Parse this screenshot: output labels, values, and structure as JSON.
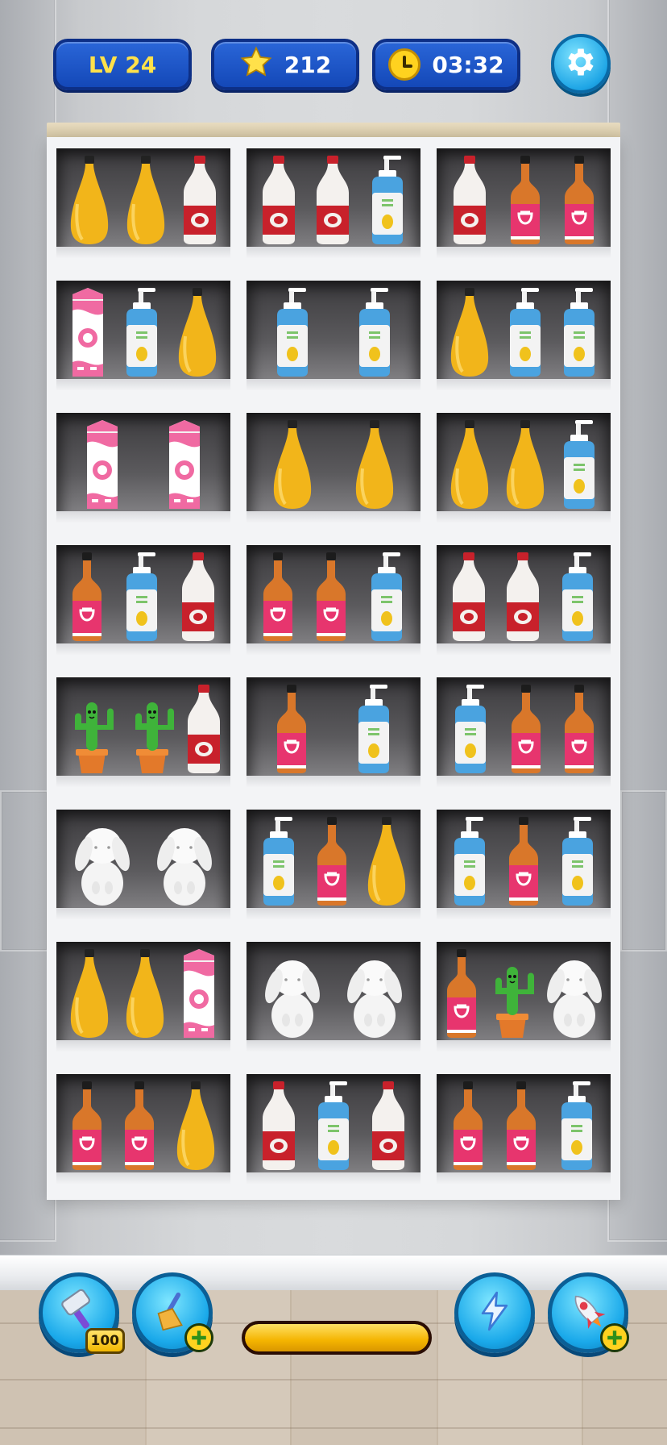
{
  "hud": {
    "level_label": "LV 24",
    "star_count": "212",
    "timer": "03:32",
    "star_icon": "star-icon",
    "clock_icon": "clock-icon",
    "settings_icon": "gear-icon"
  },
  "shelf": {
    "rows": [
      [
        [
          "mustard-bottle",
          "mustard-bottle",
          "milk-bottle"
        ],
        [
          "milk-bottle",
          "milk-bottle",
          "lotion-pump"
        ],
        [
          "milk-bottle",
          "sauce-bottle",
          "sauce-bottle"
        ]
      ],
      [
        [
          "milk-carton",
          "lotion-pump",
          "mustard-bottle"
        ],
        [
          "lotion-pump",
          "lotion-pump"
        ],
        [
          "mustard-bottle",
          "lotion-pump",
          "lotion-pump"
        ]
      ],
      [
        [
          "milk-carton",
          "milk-carton"
        ],
        [
          "mustard-bottle",
          "mustard-bottle"
        ],
        [
          "mustard-bottle",
          "mustard-bottle",
          "lotion-pump"
        ]
      ],
      [
        [
          "sauce-bottle",
          "lotion-pump",
          "milk-bottle"
        ],
        [
          "sauce-bottle",
          "sauce-bottle",
          "lotion-pump"
        ],
        [
          "milk-bottle",
          "milk-bottle",
          "lotion-pump"
        ]
      ],
      [
        [
          "cactus-pot",
          "cactus-pot",
          "milk-bottle"
        ],
        [
          "sauce-bottle",
          "lotion-pump"
        ],
        [
          "lotion-pump",
          "sauce-bottle",
          "sauce-bottle"
        ]
      ],
      [
        [
          "bunny-figure",
          "bunny-figure"
        ],
        [
          "lotion-pump",
          "sauce-bottle",
          "mustard-bottle"
        ],
        [
          "lotion-pump",
          "sauce-bottle",
          "lotion-pump"
        ]
      ],
      [
        [
          "mustard-bottle",
          "mustard-bottle",
          "milk-carton"
        ],
        [
          "bunny-figure",
          "bunny-figure"
        ],
        [
          "sauce-bottle",
          "cactus-pot",
          "bunny-figure"
        ]
      ],
      [
        [
          "sauce-bottle",
          "sauce-bottle",
          "mustard-bottle"
        ],
        [
          "milk-bottle",
          "lotion-pump",
          "milk-bottle"
        ],
        [
          "sauce-bottle",
          "sauce-bottle",
          "lotion-pump"
        ]
      ]
    ]
  },
  "toolbar": {
    "hammer_icon": "hammer-icon",
    "hammer_count": "100",
    "broom_icon": "broom-icon",
    "lightning_icon": "lightning-icon",
    "rocket_icon": "rocket-icon",
    "progress": 1.0
  }
}
